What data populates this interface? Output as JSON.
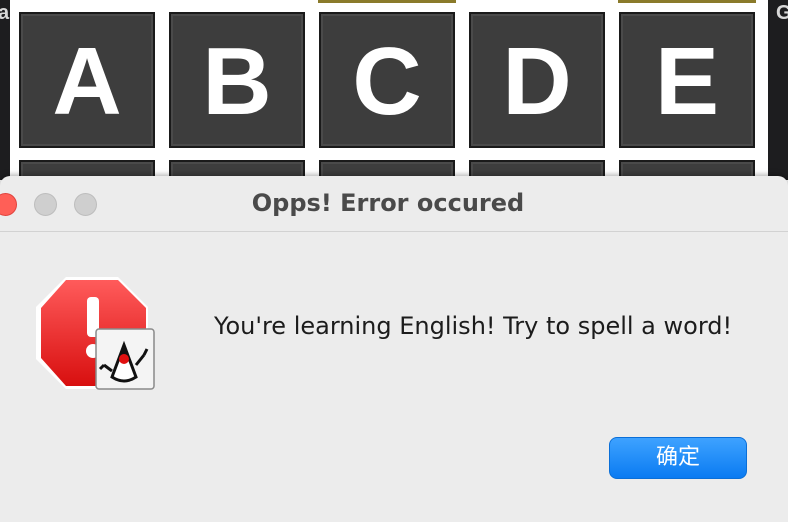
{
  "board": {
    "left_fragment": "a",
    "right_fragment": "G",
    "tiles": [
      "A",
      "B",
      "C",
      "D",
      "E"
    ],
    "tile_color": "#3d3d3d",
    "letter_color": "#ffffff"
  },
  "dialog": {
    "title": "Opps! Error occured",
    "message": "You're learning English! Try to spell a word!",
    "ok_label": "确定",
    "icon": "error-stop-sign-icon",
    "badge_icon": "java-duke-icon",
    "button_color": "#0a7bf2"
  }
}
